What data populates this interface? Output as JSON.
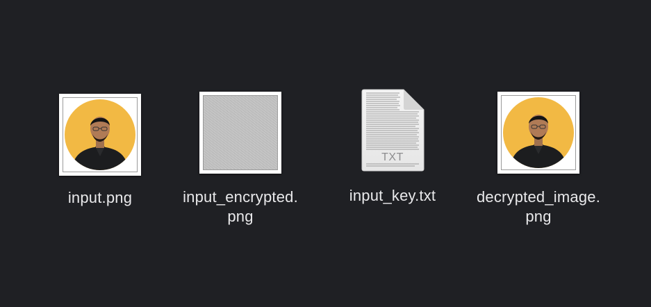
{
  "files": [
    {
      "name": "input.png",
      "kind": "image",
      "thumbnail": "portrait"
    },
    {
      "name_line1": "input_encrypted.",
      "name_line2": "png",
      "kind": "image",
      "thumbnail": "noise"
    },
    {
      "name": "input_key.txt",
      "kind": "text",
      "icon_label": "TXT"
    },
    {
      "name_line1": "decrypted_image.",
      "name_line2": "png",
      "kind": "image",
      "thumbnail": "portrait"
    }
  ],
  "colors": {
    "background": "#1f2024",
    "label_text": "#e9e9eb",
    "portrait_circle": "#f2b944",
    "jacket": "#1c1d1f"
  }
}
